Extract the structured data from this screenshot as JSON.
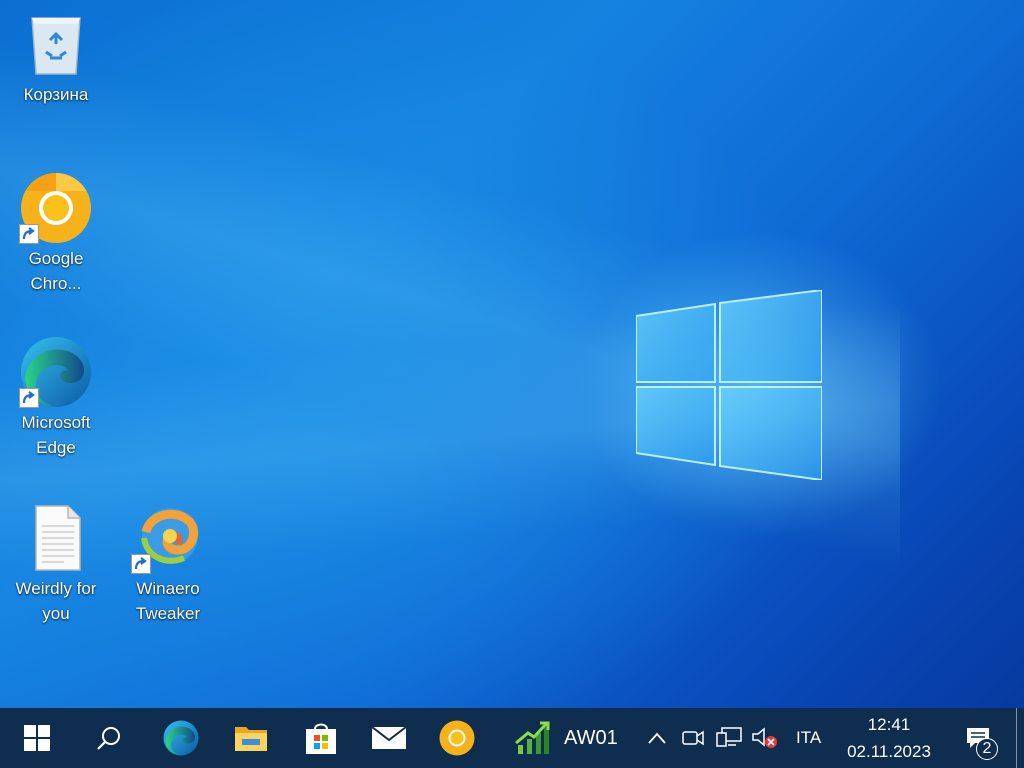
{
  "desktop": {
    "icons": [
      {
        "name": "recycle-bin",
        "label": "Корзина"
      },
      {
        "name": "google-chrome",
        "label": "Google Chro..."
      },
      {
        "name": "microsoft-edge",
        "label": "Microsoft Edge"
      },
      {
        "name": "text-file",
        "label": "Weirdly for you"
      },
      {
        "name": "winaero-tweaker",
        "label": "Winaero Tweaker"
      }
    ]
  },
  "taskbar": {
    "pinned": [
      "start-icon",
      "search-icon",
      "edge-icon",
      "file-explorer-icon",
      "microsoft-store-icon",
      "mail-icon",
      "chrome-canary-icon"
    ],
    "app_label": "AW01",
    "tray": {
      "language": "ITA",
      "time": "12:41",
      "date": "02.11.2023",
      "notification_count": "2"
    }
  },
  "colors": {
    "taskbar_bg": "#0e2d4f",
    "desktop_blue": "#0a6fd1",
    "logo_glow": "#8fe3ff"
  }
}
